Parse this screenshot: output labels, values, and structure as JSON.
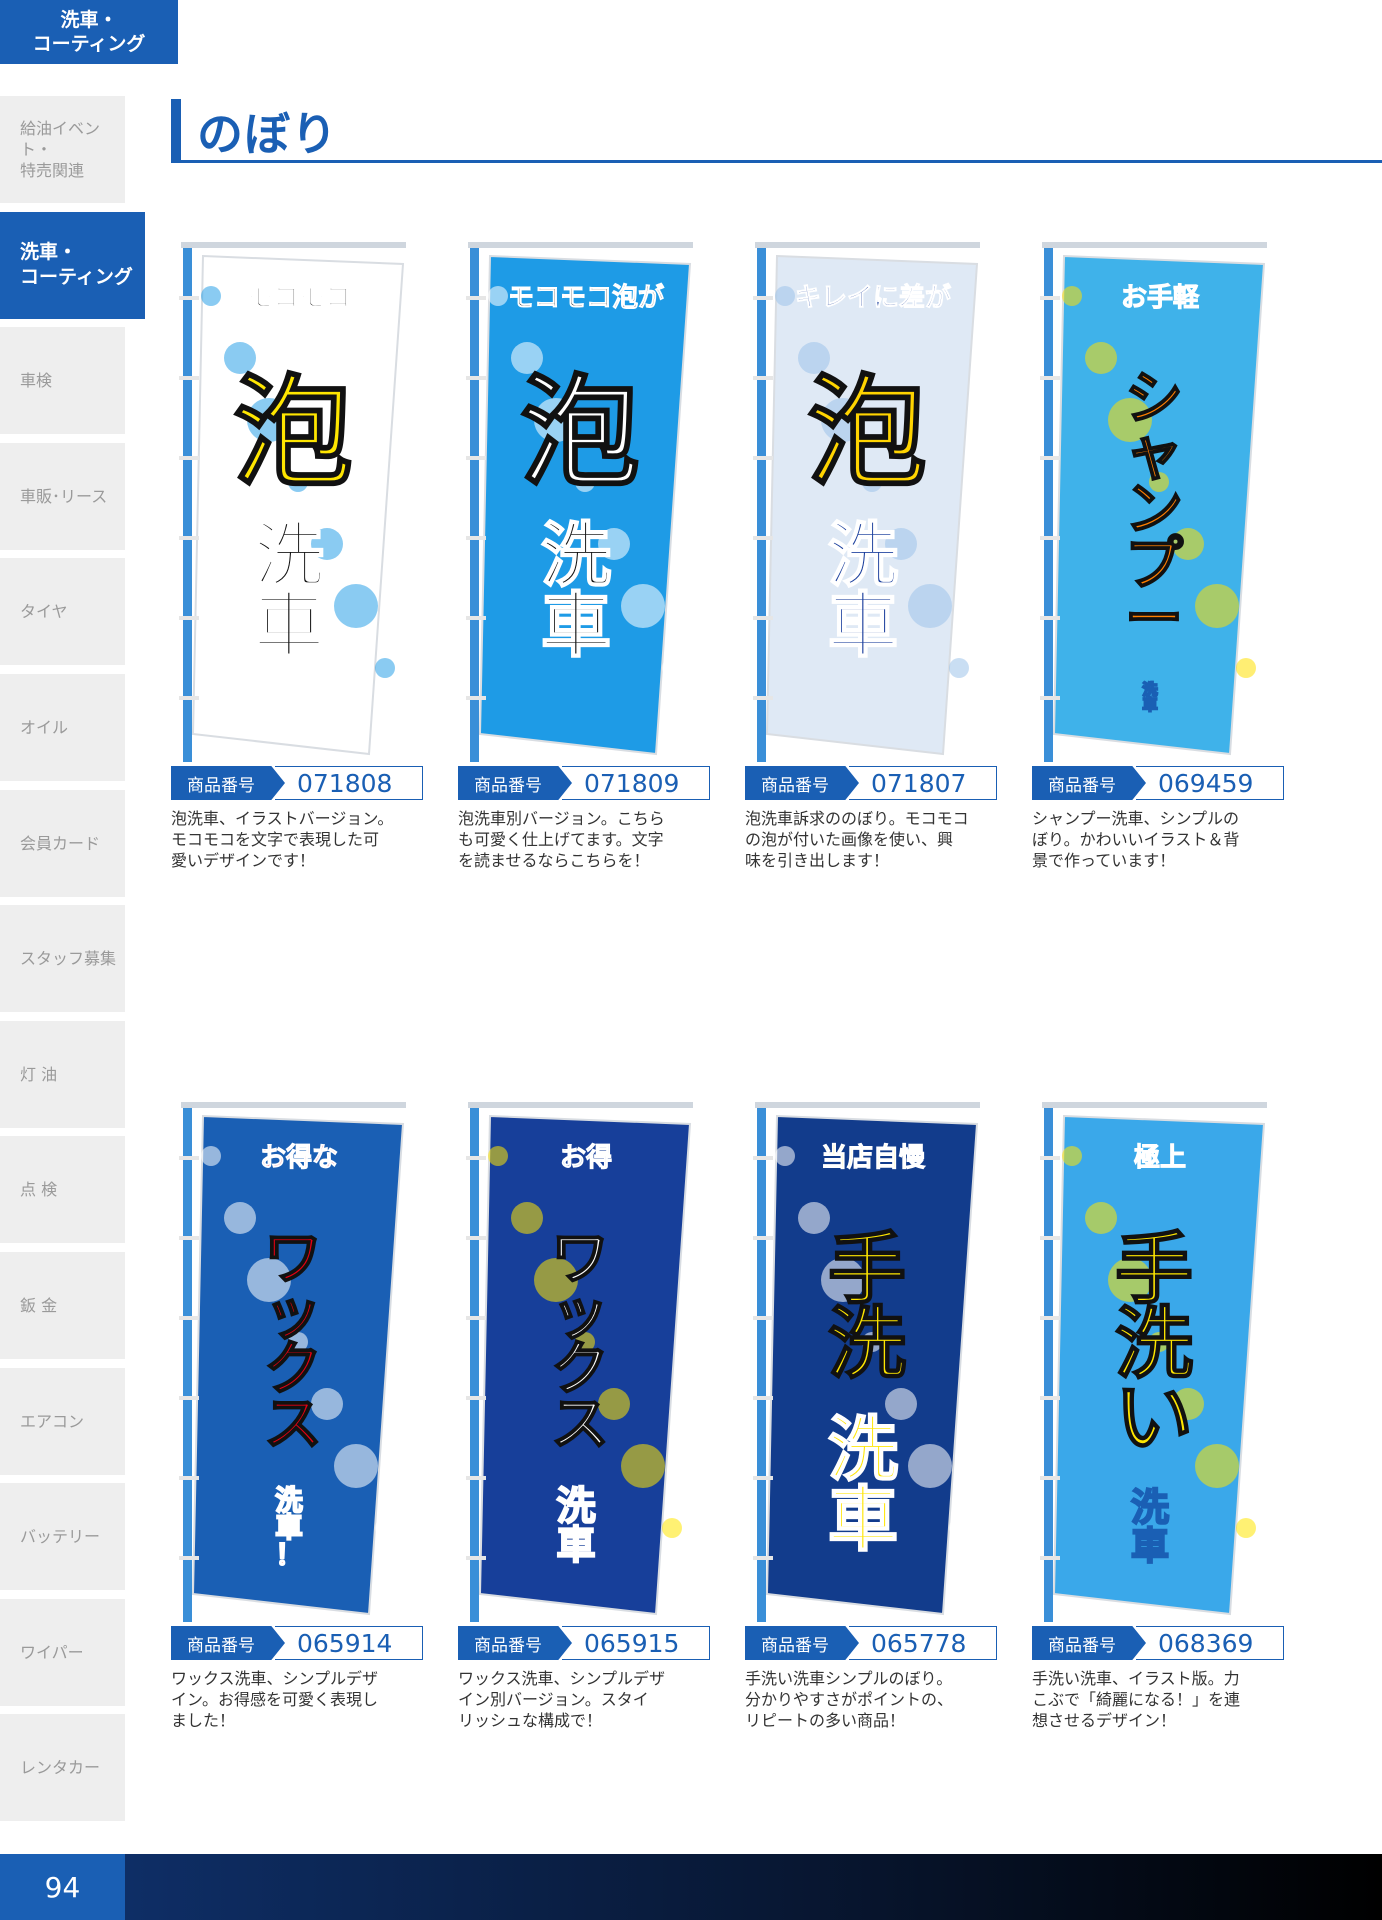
{
  "corner_tab": {
    "line1": "洗車・",
    "line2": "コーティング"
  },
  "sidebar": {
    "items": [
      {
        "line1": "給油イベント・",
        "line2": "特売関連",
        "active": false
      },
      {
        "line1": "洗車・",
        "line2": "コーティング",
        "active": true
      },
      {
        "line1": "車検",
        "line2": "",
        "active": false
      },
      {
        "line1": "車販･リース",
        "line2": "",
        "active": false
      },
      {
        "line1": "タイヤ",
        "line2": "",
        "active": false
      },
      {
        "line1": "オイル",
        "line2": "",
        "active": false
      },
      {
        "line1": "会員カード",
        "line2": "",
        "active": false
      },
      {
        "line1": "スタッフ募集",
        "line2": "",
        "active": false
      },
      {
        "line1": "灯 油",
        "line2": "",
        "active": false
      },
      {
        "line1": "点 検",
        "line2": "",
        "active": false
      },
      {
        "line1": "鈑 金",
        "line2": "",
        "active": false
      },
      {
        "line1": "エアコン",
        "line2": "",
        "active": false
      },
      {
        "line1": "バッテリー",
        "line2": "",
        "active": false
      },
      {
        "line1": "ワイパー",
        "line2": "",
        "active": false
      },
      {
        "line1": "レンタカー",
        "line2": "",
        "active": false
      }
    ]
  },
  "header": {
    "title": "のぼり"
  },
  "id_label": "商品番号",
  "products": [
    {
      "id": "071808",
      "desc": [
        "泡洗車、イラストバージョン。",
        "モコモコを文字で表現した可",
        "愛いデザインです！"
      ],
      "flag": {
        "bg": "#ffffff",
        "accent": "#2aa0e8",
        "sub": "モコモコ",
        "main": "泡",
        "bottom": "洗車",
        "main_color": "#ffe600",
        "text_color": "#111111"
      }
    },
    {
      "id": "071809",
      "desc": [
        "泡洗車別バージョン。こちら",
        "も可愛く仕上げてます。文字",
        "を読ませるならこちらを！"
      ],
      "flag": {
        "bg": "#1e9be6",
        "accent": "#ffffff",
        "sub": "モコモコ泡が汚れを落とす",
        "main": "泡",
        "bottom": "洗車",
        "main_color": "#ffffff",
        "text_color": "#111111"
      }
    },
    {
      "id": "071807",
      "desc": [
        "泡洗車訴求ののぼり。モコモコ",
        "の泡が付いた画像を使い、興",
        "味を引き出します！"
      ],
      "flag": {
        "bg": "#dfe9f5",
        "accent": "#9cc2ea",
        "sub": "キレイに差がつく",
        "main": "泡",
        "bottom": "洗車",
        "main_color": "#ffd400",
        "text_color": "#1a3e9c"
      }
    },
    {
      "id": "069459",
      "desc": [
        "シャンプー洗車、シンプルの",
        "ぼり。かわいいイラスト＆背",
        "景で作っています！"
      ],
      "flag": {
        "bg": "#3fb2ea",
        "accent": "#ffe000",
        "sub": "お手軽",
        "main": "シャンプー",
        "bottom": "洗車",
        "main_color": "#ff7f00",
        "text_color": "#ffffff"
      }
    },
    {
      "id": "065914",
      "desc": [
        "ワックス洗車、シンプルデザ",
        "イン。お得感を可愛く表現し",
        "ました！"
      ],
      "flag": {
        "bg": "#1a5fb4",
        "accent": "#ffffff",
        "sub": "お得な",
        "main": "ワックス",
        "bottom": "洗車！",
        "main_color": "#e60012",
        "text_color": "#e60012"
      }
    },
    {
      "id": "065915",
      "desc": [
        "ワックス洗車、シンプルデザ",
        "イン別バージョン。スタイ",
        "リッシュな構成で！"
      ],
      "flag": {
        "bg": "#173f9a",
        "accent": "#ffe600",
        "sub": "お得",
        "main": "ワックス",
        "bottom": "洗車",
        "main_color": "#ffffff",
        "text_color": "#173f9a"
      }
    },
    {
      "id": "065778",
      "desc": [
        "手洗い洗車シンプルのぼり。",
        "分かりやすさがポイントの、",
        "リピートの多い商品！"
      ],
      "flag": {
        "bg": "#123c8c",
        "accent": "#ffffff",
        "sub": "当店自慢",
        "main": "手洗",
        "bottom": "洗車",
        "main_color": "#ffe600",
        "text_color": "#ffe600"
      }
    },
    {
      "id": "068369",
      "desc": [
        "手洗い洗車、イラスト版。力",
        "こぶで「綺麗になる！」を連",
        "想させるデザイン！"
      ],
      "flag": {
        "bg": "#3aa8ea",
        "accent": "#ffe600",
        "sub": "極上",
        "main": "手洗い",
        "bottom": "洗車",
        "main_color": "#ffe600",
        "text_color": "#ffffff"
      }
    }
  ],
  "footer": {
    "page_number": "94"
  }
}
